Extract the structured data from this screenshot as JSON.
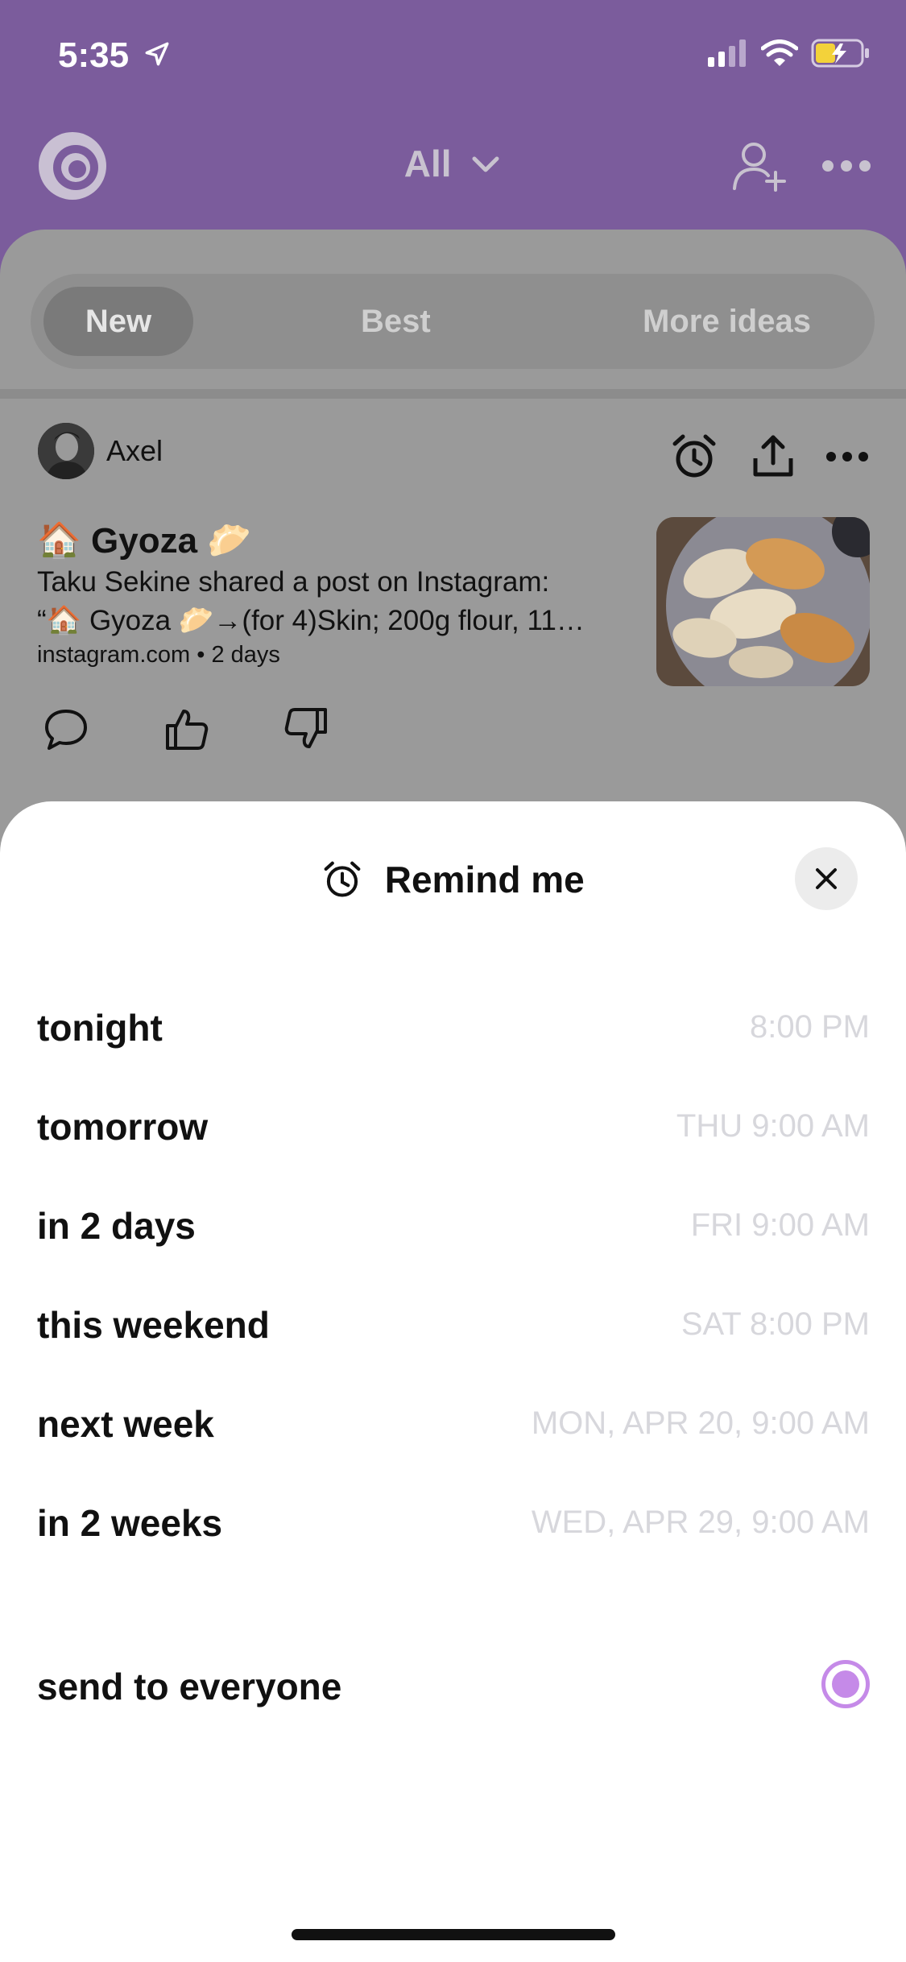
{
  "status_bar": {
    "time": "5:35"
  },
  "header": {
    "filter_label": "All"
  },
  "segments": {
    "new": "New",
    "best": "Best",
    "more_ideas": "More ideas"
  },
  "post": {
    "author": "Axel",
    "title": "🏠 Gyoza 🥟",
    "description_line1": "Taku Sekine shared a post on Instagram:",
    "description_line2": "“🏠 Gyoza 🥟→(for 4)Skin; 200g flour, 11…",
    "source": "instagram.com • 2 days"
  },
  "remind_sheet": {
    "title": "Remind me",
    "options": [
      {
        "label": "tonight",
        "time": "8:00 PM"
      },
      {
        "label": "tomorrow",
        "time": "THU 9:00 AM"
      },
      {
        "label": "in 2 days",
        "time": "FRI 9:00 AM"
      },
      {
        "label": "this weekend",
        "time": "SAT 8:00 PM"
      },
      {
        "label": "next week",
        "time": "MON, APR 20, 9:00 AM"
      },
      {
        "label": "in 2 weeks",
        "time": "WED, APR 29, 9:00 AM"
      }
    ],
    "send_label": "send to everyone",
    "send_selected": true
  },
  "colors": {
    "brand_purple": "#7b5c9c",
    "radio_accent": "#c58ae8",
    "muted_time": "#d7d7dc"
  },
  "icons": [
    "location-arrow-icon",
    "signal-icon",
    "wifi-icon",
    "battery-icon",
    "app-logo-icon",
    "chevron-down-icon",
    "add-person-icon",
    "more-icon",
    "alarm-icon",
    "share-icon",
    "comment-icon",
    "thumbs-up-icon",
    "thumbs-down-icon",
    "close-icon"
  ]
}
